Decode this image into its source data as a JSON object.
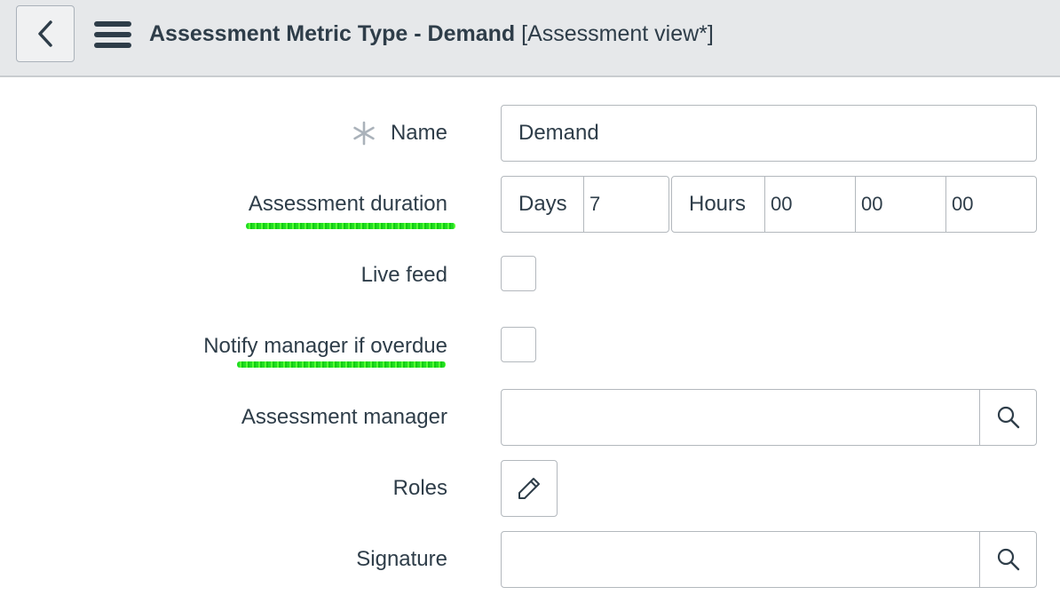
{
  "header": {
    "title": "Assessment Metric Type - Demand",
    "view": "[Assessment view*]",
    "back_icon": "chevron-left-icon",
    "menu_icon": "hamburger-menu-icon"
  },
  "form": {
    "name": {
      "label": "Name",
      "value": "Demand",
      "required": true
    },
    "assessment_duration": {
      "label": "Assessment duration",
      "days_label": "Days",
      "days_value": "7",
      "hours_label": "Hours",
      "hours_value": "00",
      "minutes_value": "00",
      "seconds_value": "00"
    },
    "live_feed": {
      "label": "Live feed",
      "checked": false
    },
    "notify_manager": {
      "label": "Notify manager if overdue",
      "checked": false
    },
    "assessment_manager": {
      "label": "Assessment manager",
      "value": ""
    },
    "roles": {
      "label": "Roles",
      "icon": "pencil-icon"
    },
    "signature": {
      "label": "Signature",
      "value": ""
    }
  },
  "colors": {
    "header_bg": "#e6e8ea",
    "text": "#2e3d49",
    "border": "#b3b8bd",
    "spellcheck_underline": "#22dd22"
  }
}
